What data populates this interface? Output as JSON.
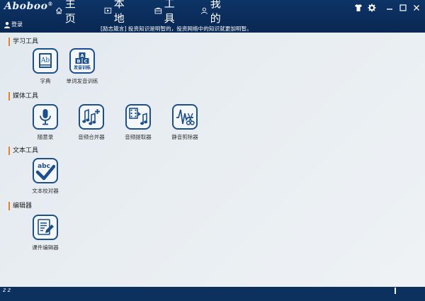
{
  "app": {
    "logo": "Aboboo",
    "logo_mark": "®"
  },
  "nav": {
    "home": "主页",
    "local": "本地",
    "tools": "工具",
    "mine": "我的"
  },
  "header": {
    "login": "登录",
    "motto": "[励志箴言] 投资知识是明智的，投资网络中的知识就更加明智。"
  },
  "sections": [
    {
      "title": "学习工具",
      "tools": [
        {
          "label": "字典",
          "icon": "dictionary-icon"
        },
        {
          "label": "单词发音训练",
          "icon": "pronunciation-icon",
          "icon_text": [
            "A",
            "B",
            "C",
            "发音训练"
          ]
        }
      ]
    },
    {
      "title": "媒体工具",
      "tools": [
        {
          "label": "随意录",
          "icon": "microphone-icon"
        },
        {
          "label": "音频合并器",
          "icon": "audio-merge-icon"
        },
        {
          "label": "音频提取器",
          "icon": "audio-extract-icon"
        },
        {
          "label": "静音剪除器",
          "icon": "silence-cut-icon"
        }
      ]
    },
    {
      "title": "文本工具",
      "tools": [
        {
          "label": "文本校对器",
          "icon": "text-proofread-icon",
          "icon_text": "abc"
        }
      ]
    },
    {
      "title": "编辑器",
      "tools": [
        {
          "label": "课件编辑器",
          "icon": "courseware-editor-icon"
        }
      ]
    }
  ],
  "dictionary_icon_text": "Ab",
  "footer": {
    "status": "z z"
  },
  "colors": {
    "topbar": "#0a2c5a",
    "accent": "#e8811f",
    "icon_blue": "#1d4f8a",
    "content_bg": "#e6ecf1"
  }
}
